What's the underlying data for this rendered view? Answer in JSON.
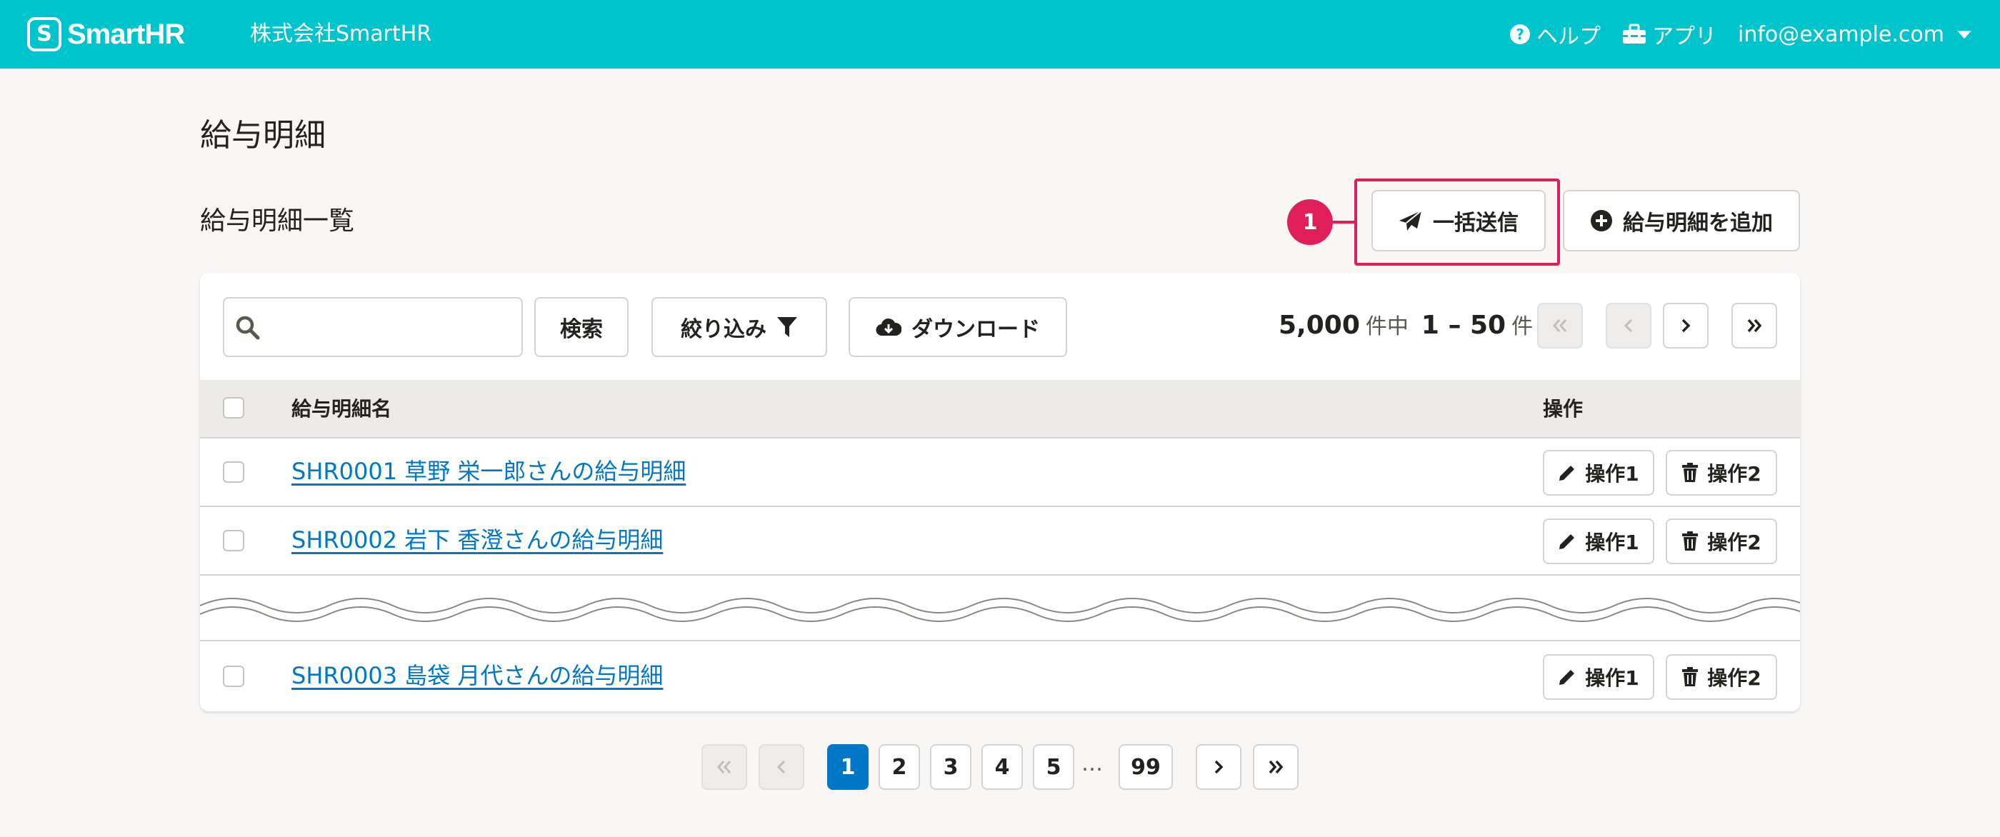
{
  "header": {
    "logo_mark": "S",
    "logo_text": "SmartHR",
    "tenant": "株式会社SmartHR",
    "help_label": "ヘルプ",
    "apps_label": "アプリ",
    "user_email": "info@example.com"
  },
  "page": {
    "title": "給与明細",
    "section_title": "給与明細一覧"
  },
  "actions": {
    "bulk_send_label": "一括送信",
    "add_label": "給与明細を追加",
    "badge_number": "1"
  },
  "toolbar": {
    "search_placeholder": "",
    "search_button": "検索",
    "filter_button": "絞り込み",
    "download_button": "ダウンロード",
    "total": "5,000",
    "total_unit": "件中",
    "range": "1 – 50",
    "range_unit": "件"
  },
  "table": {
    "columns": [
      "給与明細名",
      "操作"
    ],
    "rows": [
      {
        "name": "SHR0001 草野 栄一郎さんの給与明細",
        "op1": "操作1",
        "op2": "操作2"
      },
      {
        "name": "SHR0002 岩下 香澄さんの給与明細",
        "op1": "操作1",
        "op2": "操作2"
      },
      {
        "name": "SHR0003 島袋 月代さんの給与明細",
        "op1": "操作1",
        "op2": "操作2"
      }
    ]
  },
  "pagination": {
    "pages": [
      "1",
      "2",
      "3",
      "4",
      "5"
    ],
    "ellipsis": "…",
    "last_page": "99",
    "current": "1"
  },
  "colors": {
    "header_bg": "#00c4cc",
    "link": "#0077c7",
    "highlight": "#e01e5a",
    "current_page": "#0077c7"
  }
}
